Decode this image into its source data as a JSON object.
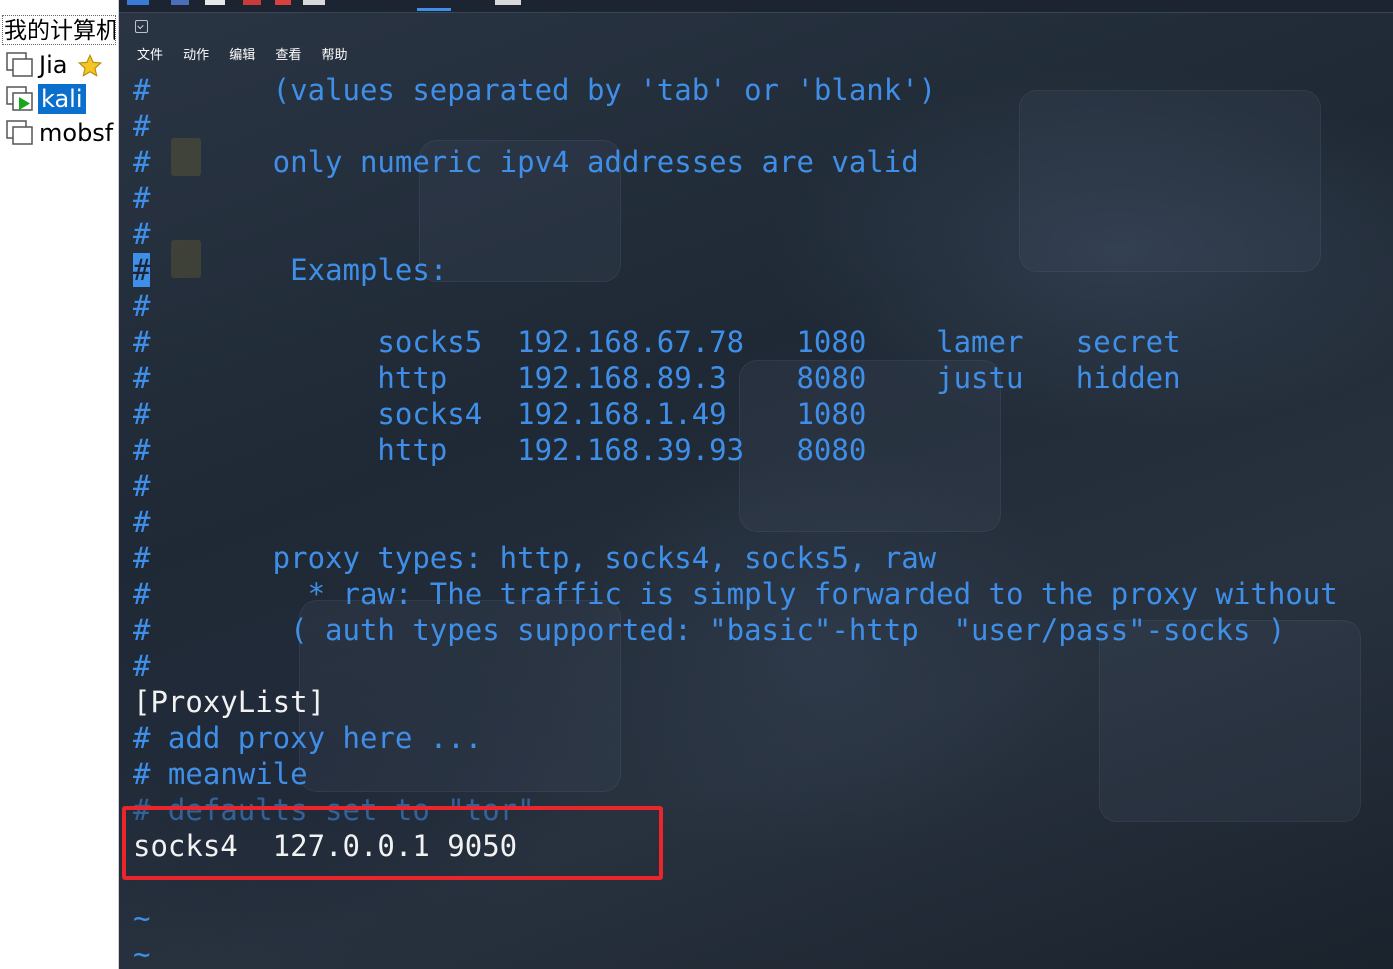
{
  "tree": {
    "root_label": "我的计算机",
    "items": [
      {
        "label": "Jia",
        "favorite": true
      },
      {
        "label": "kali",
        "selected": true,
        "running": true
      },
      {
        "label": "mobsf"
      }
    ]
  },
  "window": {
    "menu": [
      "文件",
      "动作",
      "编辑",
      "查看",
      "帮助"
    ]
  },
  "terminal": {
    "lines": [
      {
        "text": "#       (values separated by 'tab' or 'blank')",
        "style": "comment"
      },
      {
        "text": "#",
        "style": "comment"
      },
      {
        "text": "#       only numeric ipv4 addresses are valid",
        "style": "comment"
      },
      {
        "text": "#",
        "style": "comment"
      },
      {
        "text": "#",
        "style": "comment"
      },
      {
        "text": "        Examples:",
        "style": "comment",
        "cursor_hash": true
      },
      {
        "text": "#",
        "style": "comment"
      },
      {
        "text": "#             socks5  192.168.67.78   1080    lamer   secret",
        "style": "comment"
      },
      {
        "text": "#             http    192.168.89.3    8080    justu   hidden",
        "style": "comment"
      },
      {
        "text": "#             socks4  192.168.1.49    1080",
        "style": "comment"
      },
      {
        "text": "#             http    192.168.39.93   8080",
        "style": "comment"
      },
      {
        "text": "#",
        "style": "comment"
      },
      {
        "text": "#",
        "style": "comment"
      },
      {
        "text": "#       proxy types: http, socks4, socks5, raw",
        "style": "comment"
      },
      {
        "text": "#         * raw: The traffic is simply forwarded to the proxy without",
        "style": "comment"
      },
      {
        "text": "#        ( auth types supported: \"basic\"-http  \"user/pass\"-socks )",
        "style": "comment"
      },
      {
        "text": "#",
        "style": "comment"
      },
      {
        "text": "[ProxyList]",
        "style": "normal"
      },
      {
        "text": "# add proxy here ...",
        "style": "comment"
      },
      {
        "text": "# meanwile",
        "style": "comment"
      },
      {
        "text": "# defaults set to \"tor\"",
        "style": "faded"
      },
      {
        "text": "socks4  127.0.0.1 9050",
        "style": "normal"
      },
      {
        "text": "",
        "style": "comment"
      },
      {
        "text": "~",
        "style": "tilde"
      },
      {
        "text": "~",
        "style": "tilde"
      }
    ]
  },
  "colors": {
    "comment": "#3f8fe8",
    "normal": "#f2f2f2",
    "highlight_box": "#e8262b",
    "selection": "#0b6fce"
  }
}
